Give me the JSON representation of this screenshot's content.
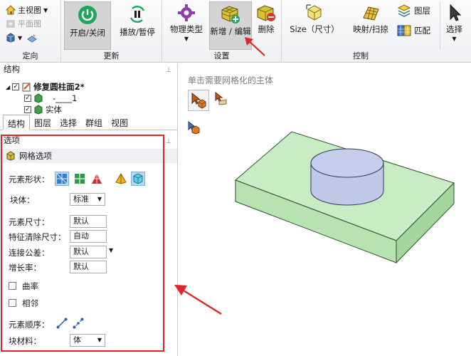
{
  "ribbon": {
    "nav_group": {
      "label": "定向",
      "main_view": "主视图",
      "plane_view": "平面图"
    },
    "update_group": {
      "label": "更新",
      "on_off": "开启/关闭",
      "play_pause": "播放/暂停"
    },
    "settings_group": {
      "label": "设置",
      "physics_type": "物理类型",
      "add_edit": "新增 / 编辑",
      "delete": "删除"
    },
    "control_group": {
      "label": "控制",
      "size": "Size（尺寸）",
      "map_sweep": "映射/扫掠",
      "layer": "图层",
      "match": "匹配",
      "select": "选择"
    }
  },
  "structure_panel": {
    "title": "结构",
    "tree": {
      "root": "修复圆柱面2*",
      "child1": "-____1",
      "child2": "实体"
    },
    "tabs": [
      "结构",
      "图层",
      "选择",
      "群组",
      "视图"
    ],
    "active_tab": "结构"
  },
  "options_panel": {
    "title": "选项",
    "mesh_options": "网格选项",
    "element_shape_label": "元素形状：",
    "block_label": "块体：",
    "block_value": "标准",
    "element_size_label": "元素尺寸：",
    "element_size_value": "默认",
    "feature_clear_label": "特征清除尺寸：",
    "feature_clear_value": "自动",
    "connect_tol_label": "连接公差：",
    "connect_tol_value": "默认",
    "growth_label": "增长率：",
    "growth_value": "默认",
    "curvature_label": "曲率",
    "proximity_label": "相邻",
    "element_order_label": "元素顺序：",
    "block_material_label": "块材料：",
    "block_material_value": "体"
  },
  "viewport": {
    "hint": "单击需要网格化的主体"
  },
  "colors": {
    "highlight_box": "#e0262b",
    "slab_top": "#c8ecc4",
    "slab_front": "#b6e3b0",
    "slab_side": "#a3d59c",
    "cylinder": "#c2c8e8"
  }
}
